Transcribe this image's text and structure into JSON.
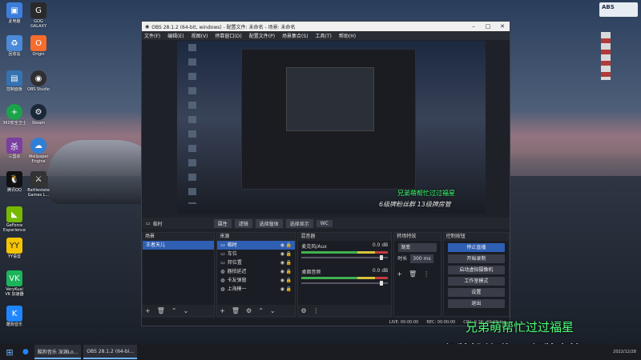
{
  "desktop": {
    "icons": [
      {
        "label": "此电脑",
        "icon": "computer-icon",
        "color": "#3d7edb"
      },
      {
        "label": "GOG GALAXY",
        "icon": "gog-icon",
        "color": "#2a2a2a"
      },
      {
        "label": "回收站",
        "icon": "recycle-bin-icon",
        "color": "#4a8ad8"
      },
      {
        "label": "Origin",
        "icon": "origin-icon",
        "color": "#f56c2d"
      },
      {
        "label": "控制面板",
        "icon": "control-panel-icon",
        "color": "#3572b0"
      },
      {
        "label": "OBS Studio",
        "icon": "obs-icon",
        "color": "#302e31"
      },
      {
        "label": "360安全卫士",
        "icon": "shield-icon",
        "color": "#1aa34a"
      },
      {
        "label": "Steam",
        "icon": "steam-icon",
        "color": "#1b2838"
      },
      {
        "label": "三国杀",
        "icon": "game-icon",
        "color": "#7a3fa0"
      },
      {
        "label": "Wallpaper Engine",
        "icon": "wallpaper-icon",
        "color": "#2f7fd6"
      },
      {
        "label": "腾讯QQ",
        "icon": "qq-icon",
        "color": "#111111"
      },
      {
        "label": "Battlestate Games L...",
        "icon": "battlestate-icon",
        "color": "#333333"
      },
      {
        "label": "GeForce Experience",
        "icon": "nvidia-icon",
        "color": "#76b900"
      },
      {
        "label": "YY语音",
        "icon": "yy-icon",
        "color": "#f5c400"
      },
      {
        "label": "VeryKuai VK 加速器",
        "icon": "vk-icon",
        "color": "#1bb45a"
      },
      {
        "label": "酷狗音乐",
        "icon": "kugou-icon",
        "color": "#1f86ff"
      }
    ],
    "logo_text": "ABS"
  },
  "obs": {
    "title": "OBS 28.1.2 (64-bit, windows) - 配置文件: 未命名 - 场景: 未命名",
    "menu": [
      "文件(F)",
      "编辑(E)",
      "视图(V)",
      "停靠窗口(D)",
      "配置文件(P)",
      "场景集合(S)",
      "工具(T)",
      "帮助(H)"
    ],
    "preview_overlay_1": "兄弟萌帮忙过过福星",
    "preview_overlay_2": "6级牌粉丝群 13级牌房管",
    "source_bar": {
      "label": "临时",
      "buttons": [
        "属性",
        "滤镜",
        "选择窗体",
        "选择显示",
        "WC"
      ]
    },
    "scenes": {
      "title": "场景",
      "items": [
        "王者天儿"
      ]
    },
    "sources": {
      "title": "来源",
      "items": [
        "临时",
        "车位",
        "邦位置",
        "器拍延迟",
        "卡友弹窗",
        "上海模一"
      ]
    },
    "mixer": {
      "title": "混音器",
      "channels": [
        {
          "name": "麦克风/Aux",
          "db": "0.0 dB"
        },
        {
          "name": "桌面音频",
          "db": "0.0 dB"
        }
      ]
    },
    "transitions": {
      "title": "转场特效",
      "type": "渐变",
      "duration_label": "时长",
      "duration": "300 ms"
    },
    "controls": {
      "title": "控制按钮",
      "buttons": [
        "停止直播",
        "开始录制",
        "启动虚拟摄像机",
        "工作室模式",
        "设置",
        "退出"
      ]
    },
    "status": {
      "live": "LIVE: 00:00:00",
      "rec": "REC: 00:00:00",
      "cpu": "CPU: 0.1%, 60.00 fps"
    }
  },
  "overlay": {
    "line1": "兄弟萌帮忙过过福星",
    "line2": "6级牌粉丝群 13级牌房管"
  },
  "taskbar": {
    "apps": [
      "酷狗音乐 深渊Lo...",
      "OBS 28.1.2 (64-bi..."
    ],
    "time": "2022/12/28"
  }
}
